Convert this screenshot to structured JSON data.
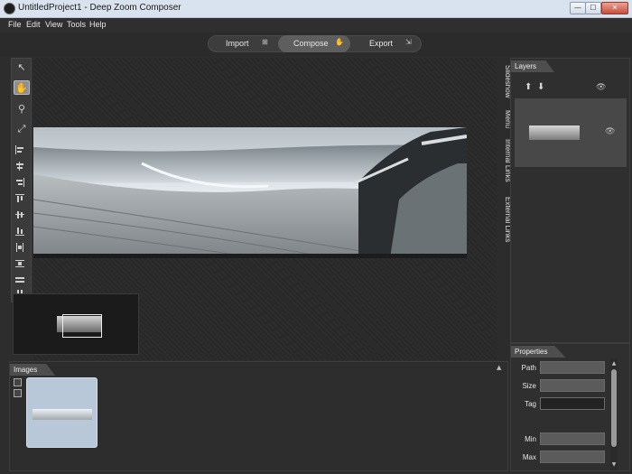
{
  "window": {
    "title": "UntitledProject1 - Deep Zoom Composer",
    "minimize": "—",
    "maximize": "☐",
    "close": "✕"
  },
  "menu": [
    "File",
    "Edit",
    "View",
    "Tools",
    "Help"
  ],
  "modes": {
    "import_label": "Import",
    "compose_label": "Compose",
    "export_label": "Export",
    "active": "Compose"
  },
  "tools": [
    {
      "name": "select-arrow-icon",
      "glyph": "↖"
    },
    {
      "name": "pan-hand-icon",
      "glyph": "✋"
    },
    {
      "name": "zoom-icon",
      "glyph": "⚲"
    },
    {
      "name": "fit-screen-icon",
      "glyph": "⤢"
    }
  ],
  "side_tabs": [
    "Slideshow",
    "Menu",
    "Internal Links",
    "External Links"
  ],
  "layers": {
    "title": "Layers",
    "up_arrow": "⬆",
    "down_arrow": "⬇",
    "visibility_icon": "👁"
  },
  "properties": {
    "title": "Properties",
    "path_label": "Path",
    "path_value": "",
    "size_label": "Size",
    "size_value": "",
    "tag_label": "Tag",
    "tag_value": "",
    "min_label": "Min",
    "min_value": "",
    "max_label": "Max",
    "max_value": ""
  },
  "images": {
    "title": "Images",
    "collapse": "▲"
  },
  "colors": {
    "background": "#2d2d2d",
    "titlebar": "#d9e3ef",
    "active_tab": "#5e5e5e",
    "image_card": "#b9c8d8"
  }
}
